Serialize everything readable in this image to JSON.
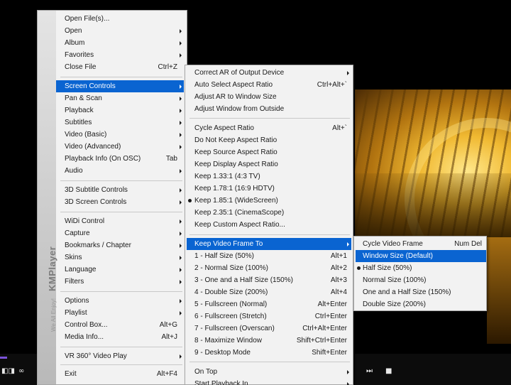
{
  "player": {
    "controls_right": [
      "⏭",
      "■"
    ],
    "controls_left": [
      "◧◨",
      "∞"
    ]
  },
  "main_menu": {
    "brand": "KMPlayer",
    "slogan": "We All Enjoy!",
    "items": [
      {
        "label": "Open File(s)...",
        "shortcut": "",
        "submenu": false
      },
      {
        "label": "Open",
        "shortcut": "",
        "submenu": true
      },
      {
        "label": "Album",
        "shortcut": "",
        "submenu": true
      },
      {
        "label": "Favorites",
        "shortcut": "",
        "submenu": true
      },
      {
        "label": "Close File",
        "shortcut": "Ctrl+Z",
        "submenu": false
      },
      {
        "label": "Screen Controls",
        "shortcut": "",
        "submenu": true,
        "highlighted": true
      },
      {
        "label": "Pan & Scan",
        "shortcut": "",
        "submenu": true
      },
      {
        "label": "Playback",
        "shortcut": "",
        "submenu": true
      },
      {
        "label": "Subtitles",
        "shortcut": "",
        "submenu": true
      },
      {
        "label": "Video (Basic)",
        "shortcut": "",
        "submenu": true
      },
      {
        "label": "Video (Advanced)",
        "shortcut": "",
        "submenu": true
      },
      {
        "label": "Playback Info (On OSC)",
        "shortcut": "Tab",
        "submenu": false
      },
      {
        "label": "Audio",
        "shortcut": "",
        "submenu": true
      },
      {
        "label": "3D Subtitle Controls",
        "shortcut": "",
        "submenu": true
      },
      {
        "label": "3D Screen Controls",
        "shortcut": "",
        "submenu": true
      },
      {
        "label": "WiDi Control",
        "shortcut": "",
        "submenu": true
      },
      {
        "label": "Capture",
        "shortcut": "",
        "submenu": true
      },
      {
        "label": "Bookmarks / Chapter",
        "shortcut": "",
        "submenu": true
      },
      {
        "label": "Skins",
        "shortcut": "",
        "submenu": true
      },
      {
        "label": "Language",
        "shortcut": "",
        "submenu": true
      },
      {
        "label": "Filters",
        "shortcut": "",
        "submenu": true
      },
      {
        "label": "Options",
        "shortcut": "",
        "submenu": true
      },
      {
        "label": "Playlist",
        "shortcut": "",
        "submenu": true
      },
      {
        "label": "Control Box...",
        "shortcut": "Alt+G",
        "submenu": false
      },
      {
        "label": "Media Info...",
        "shortcut": "Alt+J",
        "submenu": false
      },
      {
        "label": "VR 360° Video Play",
        "shortcut": "",
        "submenu": true
      },
      {
        "label": "Exit",
        "shortcut": "Alt+F4",
        "submenu": false
      }
    ]
  },
  "screen_controls_menu": {
    "items": [
      {
        "label": "Correct AR of Output Device",
        "shortcut": "",
        "submenu": true
      },
      {
        "label": "Auto Select Aspect Ratio",
        "shortcut": "Ctrl+Alt+`",
        "submenu": false
      },
      {
        "label": "Adjust AR to Window Size",
        "shortcut": "",
        "submenu": false
      },
      {
        "label": "Adjust Window from Outside",
        "shortcut": "",
        "submenu": false
      },
      {
        "label": "Cycle Aspect Ratio",
        "shortcut": "Alt+`",
        "submenu": false
      },
      {
        "label": "Do Not Keep Aspect Ratio",
        "shortcut": "",
        "submenu": false
      },
      {
        "label": "Keep Source Aspect Ratio",
        "shortcut": "",
        "submenu": false
      },
      {
        "label": "Keep Display Aspect Ratio",
        "shortcut": "",
        "submenu": false
      },
      {
        "label": "Keep 1.33:1 (4:3 TV)",
        "shortcut": "",
        "submenu": false
      },
      {
        "label": "Keep 1.78:1 (16:9 HDTV)",
        "shortcut": "",
        "submenu": false
      },
      {
        "label": "Keep 1.85:1 (WideScreen)",
        "shortcut": "",
        "submenu": false,
        "checked": true
      },
      {
        "label": "Keep 2.35:1 (CinemaScope)",
        "shortcut": "",
        "submenu": false
      },
      {
        "label": "Keep Custom Aspect Ratio...",
        "shortcut": "",
        "submenu": false
      },
      {
        "label": "Keep Video Frame To",
        "shortcut": "",
        "submenu": true,
        "highlighted": true
      },
      {
        "label": "1 - Half Size (50%)",
        "shortcut": "Alt+1",
        "submenu": false
      },
      {
        "label": "2 - Normal Size (100%)",
        "shortcut": "Alt+2",
        "submenu": false
      },
      {
        "label": "3 - One and a Half Size (150%)",
        "shortcut": "Alt+3",
        "submenu": false
      },
      {
        "label": "4 - Double Size (200%)",
        "shortcut": "Alt+4",
        "submenu": false
      },
      {
        "label": "5 - Fullscreen (Normal)",
        "shortcut": "Alt+Enter",
        "submenu": false
      },
      {
        "label": "6 - Fullscreen (Stretch)",
        "shortcut": "Ctrl+Enter",
        "submenu": false
      },
      {
        "label": "7 - Fullscreen (Overscan)",
        "shortcut": "Ctrl+Alt+Enter",
        "submenu": false
      },
      {
        "label": "8 - Maximize Window",
        "shortcut": "Shift+Ctrl+Enter",
        "submenu": false
      },
      {
        "label": "9 - Desktop Mode",
        "shortcut": "Shift+Enter",
        "submenu": false
      },
      {
        "label": "On Top",
        "shortcut": "",
        "submenu": true
      },
      {
        "label": "Start Playback In",
        "shortcut": "",
        "submenu": true
      }
    ]
  },
  "frame_menu": {
    "items": [
      {
        "label": "Cycle Video Frame",
        "shortcut": "Num Del",
        "submenu": false
      },
      {
        "label": "Window Size (Default)",
        "shortcut": "",
        "submenu": false,
        "highlighted": true
      },
      {
        "label": "Half Size (50%)",
        "shortcut": "",
        "submenu": false,
        "checked": true
      },
      {
        "label": "Normal Size (100%)",
        "shortcut": "",
        "submenu": false
      },
      {
        "label": "One and a Half Size (150%)",
        "shortcut": "",
        "submenu": false
      },
      {
        "label": "Double Size (200%)",
        "shortcut": "",
        "submenu": false
      }
    ]
  },
  "colors": {
    "menu_background": "#f2f2f2",
    "highlight": "#0a64d1",
    "player_background": "#000000",
    "seek_accent": "#7a52d8"
  }
}
